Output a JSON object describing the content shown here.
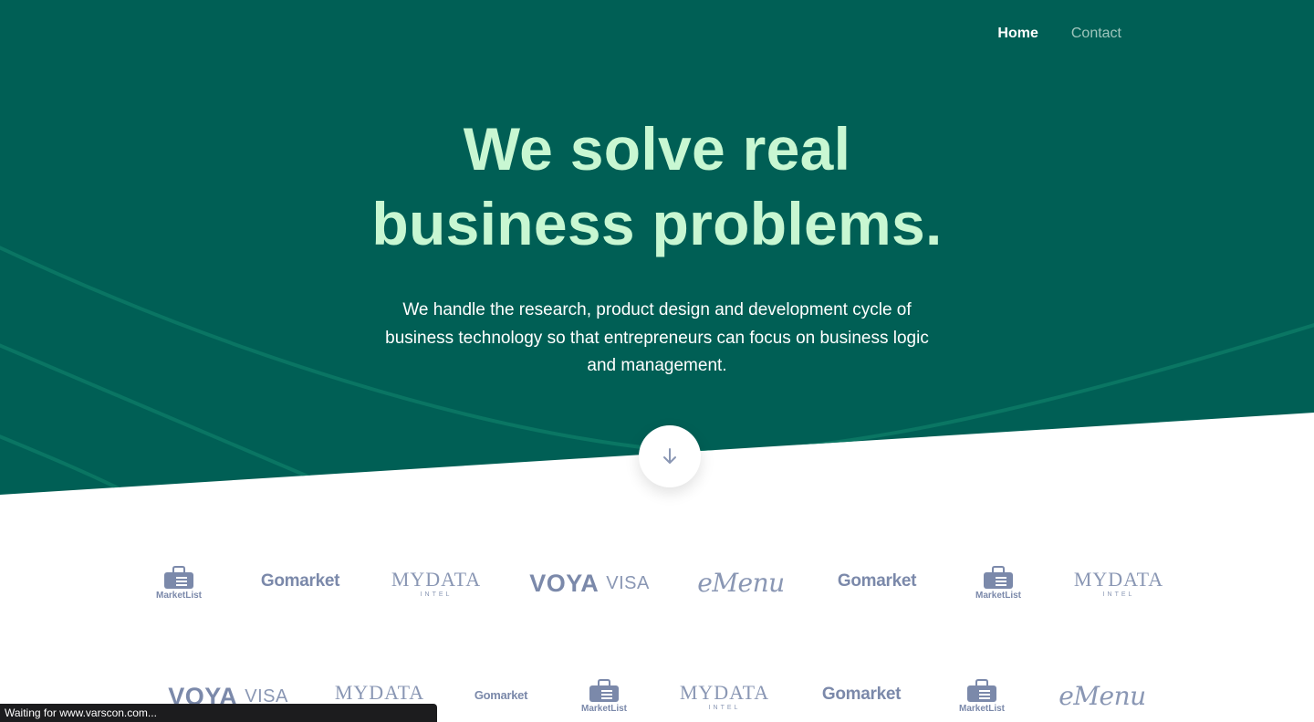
{
  "nav": {
    "items": [
      {
        "label": "Home",
        "active": true
      },
      {
        "label": "Contact",
        "active": false
      }
    ]
  },
  "hero": {
    "headline_line1": "We solve real",
    "headline_line2": "business problems.",
    "subtext": "We handle the research, product design and development cycle of business technology so that entrepreneurs can focus on business logic and management.",
    "scroll_icon": "arrow-down-icon"
  },
  "logos": {
    "marketlist": "MarketList",
    "gomarket": "Gomarket",
    "mydata": "MYDATA",
    "mydata_sub": "INTEL",
    "voya": "VOYA",
    "visa": "VISA",
    "emenu": "eMenu"
  },
  "status": {
    "text": "Waiting for www.varscon.com..."
  },
  "colors": {
    "hero_bg": "#005f55",
    "headline": "#c8f7d2",
    "logo": "#7b89aa"
  }
}
